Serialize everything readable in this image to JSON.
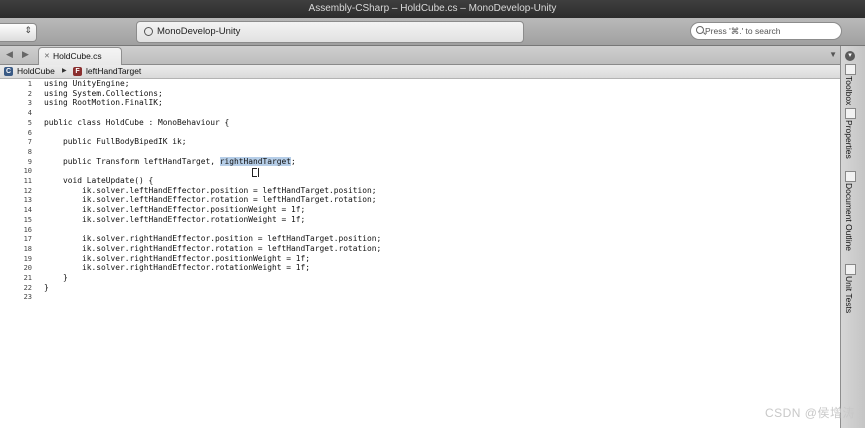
{
  "window": {
    "title": "Assembly-CSharp – HoldCube.cs – MonoDevelop-Unity"
  },
  "toolbar": {
    "status_text": "MonoDevelop-Unity",
    "search_placeholder": "Press '⌘.' to search"
  },
  "tabs": [
    {
      "label": "HoldCube.cs",
      "close": "✕"
    }
  ],
  "tabbar": {
    "back": "◀",
    "forward": "▶",
    "dropdown": "▼"
  },
  "breadcrumb": {
    "class_icon": "C",
    "class_name": "HoldCube",
    "separator": "▶",
    "member_icon": "F",
    "member_name": "leftHandTarget"
  },
  "code": {
    "line_numbers": [
      "1",
      "2",
      "3",
      "4",
      "5",
      "6",
      "7",
      "8",
      "9",
      "10",
      "11",
      "12",
      "13",
      "14",
      "15",
      "16",
      "17",
      "18",
      "19",
      "20",
      "21",
      "22",
      "23"
    ],
    "lines": [
      "using UnityEngine;",
      "using System.Collections;",
      "using RootMotion.FinalIK;",
      "",
      "public class HoldCube : MonoBehaviour {",
      "",
      "    public FullBodyBipedIK ik;",
      "",
      "    public Transform leftHandTarget, ",
      "",
      "    void LateUpdate() {",
      "        ik.solver.leftHandEffector.position = leftHandTarget.position;",
      "        ik.solver.leftHandEffector.rotation = leftHandTarget.rotation;",
      "        ik.solver.leftHandEffector.positionWeight = 1f;",
      "        ik.solver.leftHandEffector.rotationWeight = 1f;",
      "",
      "        ik.solver.rightHandEffector.position = leftHandTarget.position;",
      "        ik.solver.rightHandEffector.rotation = leftHandTarget.rotation;",
      "        ik.solver.rightHandEffector.positionWeight = 1f;",
      "        ik.solver.rightHandEffector.rotationWeight = 1f;",
      "    }",
      "}",
      ""
    ],
    "selected_text": "rightHandTarget",
    "after_selection": ";"
  },
  "sidebar": {
    "dropdown": "▾",
    "tabs": [
      {
        "label": "Toolbox"
      },
      {
        "label": "Properties"
      },
      {
        "label": "Document Outline"
      },
      {
        "label": "Unit Tests"
      }
    ]
  },
  "watermark": "CSDN @侯增涛"
}
